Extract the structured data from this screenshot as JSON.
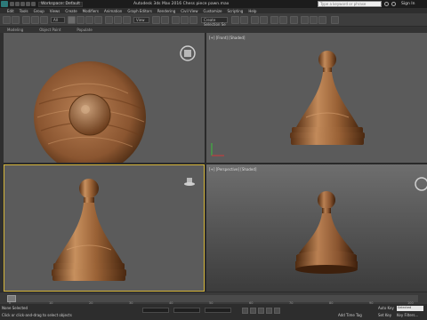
{
  "titlebar": {
    "workspace": "Workspace: Default",
    "title": "Autodesk 3ds Max 2016    Chess piece pawn.max",
    "search_placeholder": "Type a keyword or phrase",
    "signin": "Sign In"
  },
  "menu": [
    "Edit",
    "Tools",
    "Group",
    "Views",
    "Create",
    "Modifiers",
    "Animation",
    "Graph Editors",
    "Rendering",
    "Civil View",
    "Customize",
    "Scripting",
    "Help"
  ],
  "ribbon": [
    "Modeling",
    "Object Paint",
    "Populate"
  ],
  "toolbar": {
    "filter_value": "All",
    "view_value": "View",
    "selection_set_placeholder": "Create Selection Se"
  },
  "viewports": {
    "front_label": "[+] [Front] [Shaded]",
    "persp_label": "[+] [Perspective] [Shaded]"
  },
  "timeline": {
    "ticks": [
      "0",
      "10",
      "20",
      "30",
      "40",
      "50",
      "60",
      "70",
      "80",
      "90",
      "100"
    ]
  },
  "status": {
    "selection": "None Selected",
    "prompt": "Click or click-and-drag to select objects",
    "auto_key": "Auto Key",
    "selected_field": "Selected",
    "set_key": "Set Key",
    "key_filters": "Key Filters...",
    "add_time_tag": "Add Time Tag"
  },
  "colors": {
    "viewport_bg": "#5b5b5b",
    "active_viewport_border": "#d4b53a",
    "wood_light": "#b5794a",
    "wood_dark": "#6e3f1e"
  }
}
